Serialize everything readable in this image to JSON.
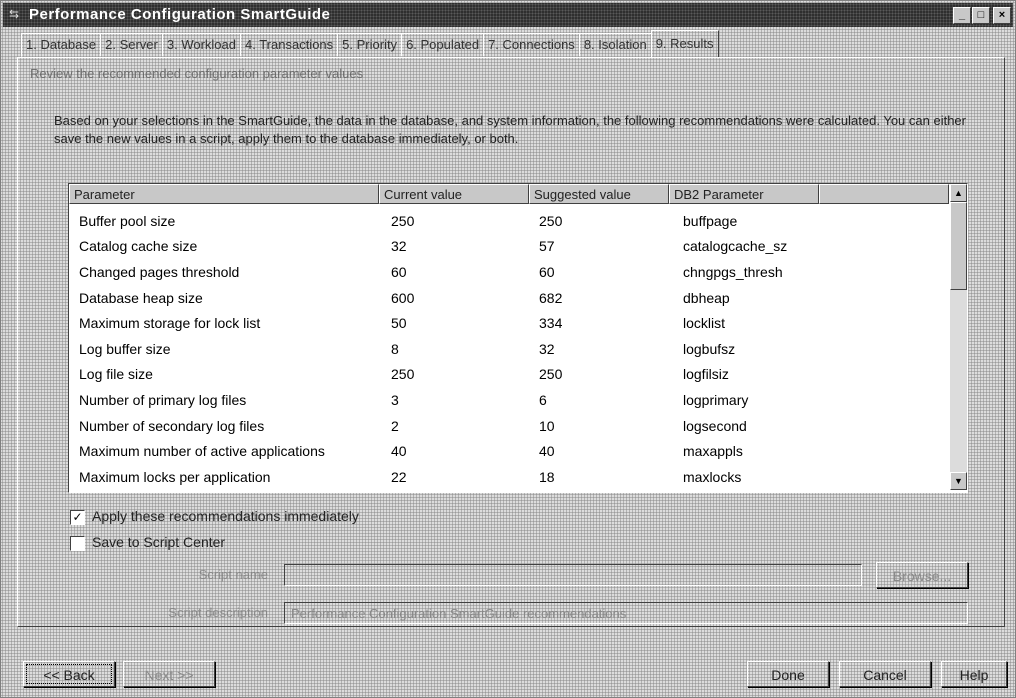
{
  "window": {
    "title": "Performance Configuration SmartGuide",
    "controls": {
      "minimize": "_",
      "maximize": "□",
      "close": "×"
    }
  },
  "tabs": [
    {
      "label": "1. Database"
    },
    {
      "label": "2. Server"
    },
    {
      "label": "3. Workload"
    },
    {
      "label": "4. Transactions"
    },
    {
      "label": "5. Priority"
    },
    {
      "label": "6. Populated"
    },
    {
      "label": "7. Connections"
    },
    {
      "label": "8. Isolation"
    },
    {
      "label": "9. Results"
    }
  ],
  "panel": {
    "headline": "Review the recommended configuration parameter values",
    "intro": "Based on your selections in the SmartGuide, the data in the database, and system information, the following recommendations were calculated. You can either save the new values in a script, apply them to the database immediately, or both."
  },
  "table": {
    "columns": [
      "Parameter",
      "Current value",
      "Suggested value",
      "DB2 Parameter"
    ],
    "rows": [
      {
        "parameter": "Buffer pool size",
        "current": "250",
        "suggested": "250",
        "db2": "buffpage"
      },
      {
        "parameter": "Catalog cache size",
        "current": "32",
        "suggested": "57",
        "db2": "catalogcache_sz"
      },
      {
        "parameter": "Changed pages threshold",
        "current": "60",
        "suggested": "60",
        "db2": "chngpgs_thresh"
      },
      {
        "parameter": "Database heap size",
        "current": "600",
        "suggested": "682",
        "db2": "dbheap"
      },
      {
        "parameter": "Maximum storage for lock list",
        "current": "50",
        "suggested": "334",
        "db2": "locklist"
      },
      {
        "parameter": "Log buffer size",
        "current": "8",
        "suggested": "32",
        "db2": "logbufsz"
      },
      {
        "parameter": "Log file size",
        "current": "250",
        "suggested": "250",
        "db2": "logfilsiz"
      },
      {
        "parameter": "Number of primary log files",
        "current": "3",
        "suggested": "6",
        "db2": "logprimary"
      },
      {
        "parameter": "Number of secondary log files",
        "current": "2",
        "suggested": "10",
        "db2": "logsecond"
      },
      {
        "parameter": "Maximum number of active applications",
        "current": "40",
        "suggested": "40",
        "db2": "maxappls"
      },
      {
        "parameter": "Maximum locks per application",
        "current": "22",
        "suggested": "18",
        "db2": "maxlocks"
      }
    ]
  },
  "options": {
    "apply_label": "Apply these recommendations immediately",
    "apply_checked": true,
    "save_label": "Save to Script Center",
    "save_checked": false,
    "script_name_label": "Script name",
    "script_name_value": "",
    "description_label": "Script description",
    "description_value": "Performance Configuration SmartGuide recommendations",
    "browse_label": "Browse..."
  },
  "buttons": {
    "back": "<< Back",
    "next": "Next >>",
    "done": "Done",
    "cancel": "Cancel",
    "help": "Help"
  }
}
